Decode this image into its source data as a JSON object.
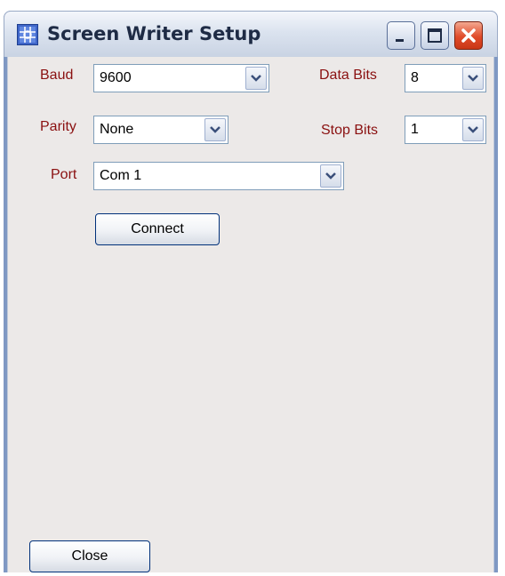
{
  "window": {
    "title": "Screen Writer Setup"
  },
  "form": {
    "baud": {
      "label": "Baud",
      "value": "9600"
    },
    "data_bits": {
      "label": "Data Bits",
      "value": "8"
    },
    "parity": {
      "label": "Parity",
      "value": "None"
    },
    "stop_bits": {
      "label": "Stop Bits",
      "value": "1"
    },
    "port": {
      "label": "Port",
      "value": "Com 1"
    }
  },
  "buttons": {
    "connect_label": "Connect",
    "close_label": "Close"
  },
  "icons": {
    "app": "app-icon",
    "minimize": "minimize-icon",
    "maximize": "maximize-icon",
    "close": "close-icon",
    "dropdown": "chevron-down-icon"
  },
  "colors": {
    "label_text": "#8a1010",
    "dialog_bg": "#ece9e8",
    "close_button": "#e04b2a"
  }
}
